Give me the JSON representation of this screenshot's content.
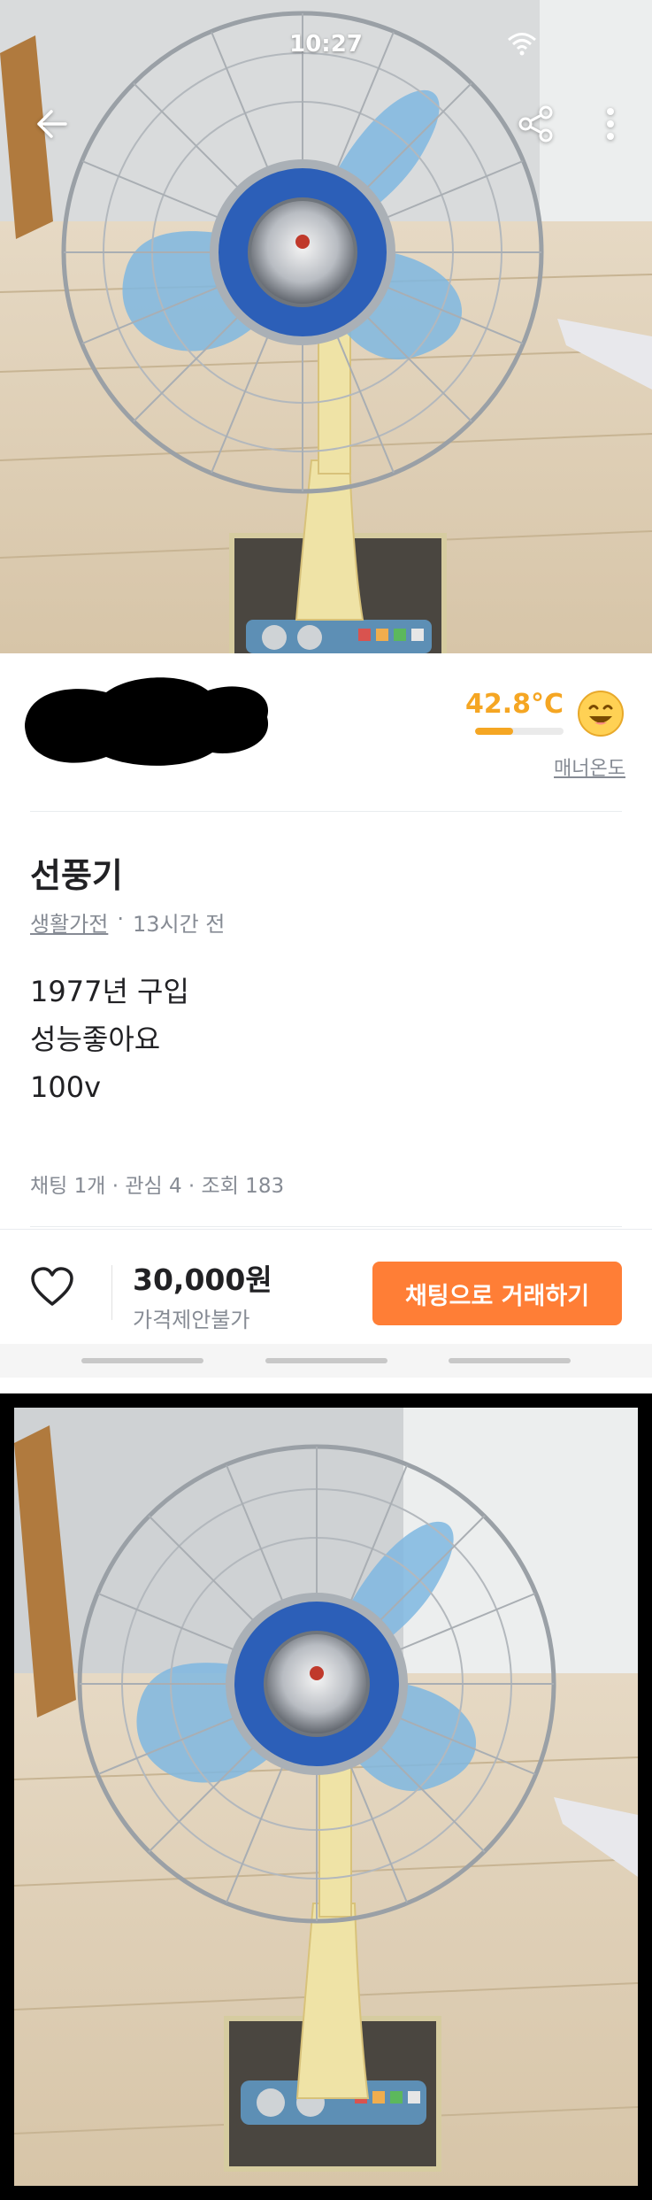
{
  "status_bar": {
    "time": "10:27"
  },
  "icons": {
    "back": "arrow-left-icon",
    "share": "share-icon",
    "more": "more-vertical-icon",
    "wifi": "wifi-icon",
    "heart": "heart-outline-icon",
    "manner": "smiling-face-icon"
  },
  "seller": {
    "manner_temp": "42.8°C",
    "manner_level": 0.43,
    "manner_label": "매너온도"
  },
  "article": {
    "title": "선풍기",
    "category": "생활가전",
    "separator": "·",
    "time_ago": "13시간 전",
    "description": [
      "1977년 구입",
      "성능좋아요",
      "100v"
    ],
    "stats": "채팅 1개 · 관심 4 · 조회 183"
  },
  "bottom": {
    "price": "30,000원",
    "negotiation": "가격제안불가",
    "chat_button": "채팅으로 거래하기"
  },
  "colors": {
    "accent": "#ff7e36",
    "manner": "#f5a623",
    "muted": "#868b94"
  }
}
